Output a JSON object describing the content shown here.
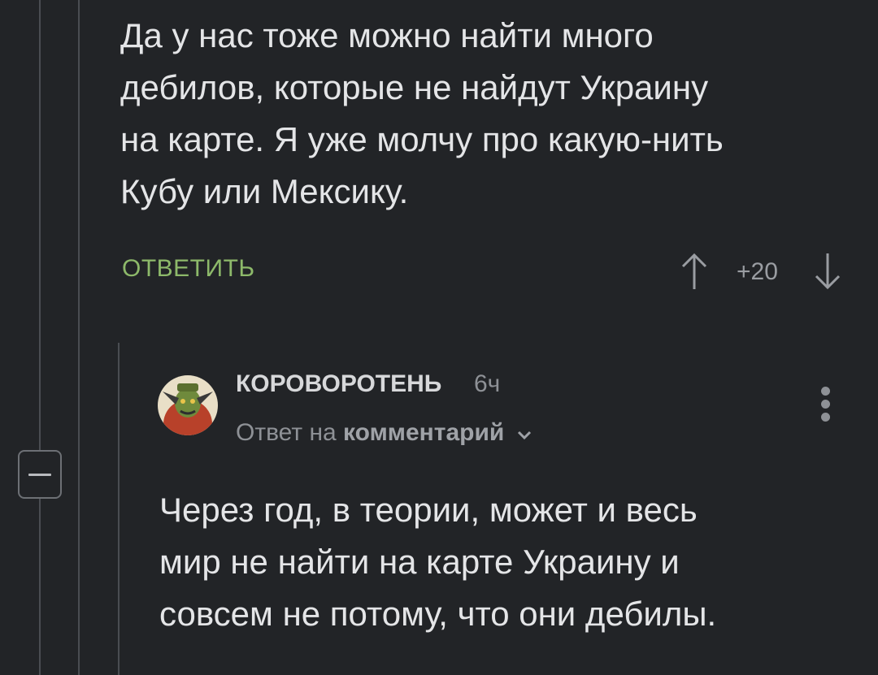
{
  "parent_comment": {
    "text": "Да у нас тоже можно найти много\nдебилов, которые не найдут Украину\nна карте. Я уже молчу про какую-нить\nКубу или Мексику.",
    "reply_label": "ОТВЕТИТЬ",
    "rating": "+20"
  },
  "reply_comment": {
    "username": "КОРОВОРОТЕНЬ",
    "time": "6ч",
    "reply_to_prefix": "Ответ на",
    "reply_to_target": "комментарий",
    "text": "Через год, в теории, может и весь\nмир не найти на карте Украину и\nсовсем не потому, что они дебилы."
  },
  "icons": {
    "upvote": "arrow-up-icon",
    "downvote": "arrow-down-icon",
    "collapse": "minus-icon",
    "more": "more-vertical-icon",
    "reply_to_toggle": "chevron-down-icon"
  },
  "colors": {
    "background": "#222427",
    "reply_accent": "#8db96a",
    "thread_line": "#4a4d52",
    "muted_text": "#8e9196"
  }
}
